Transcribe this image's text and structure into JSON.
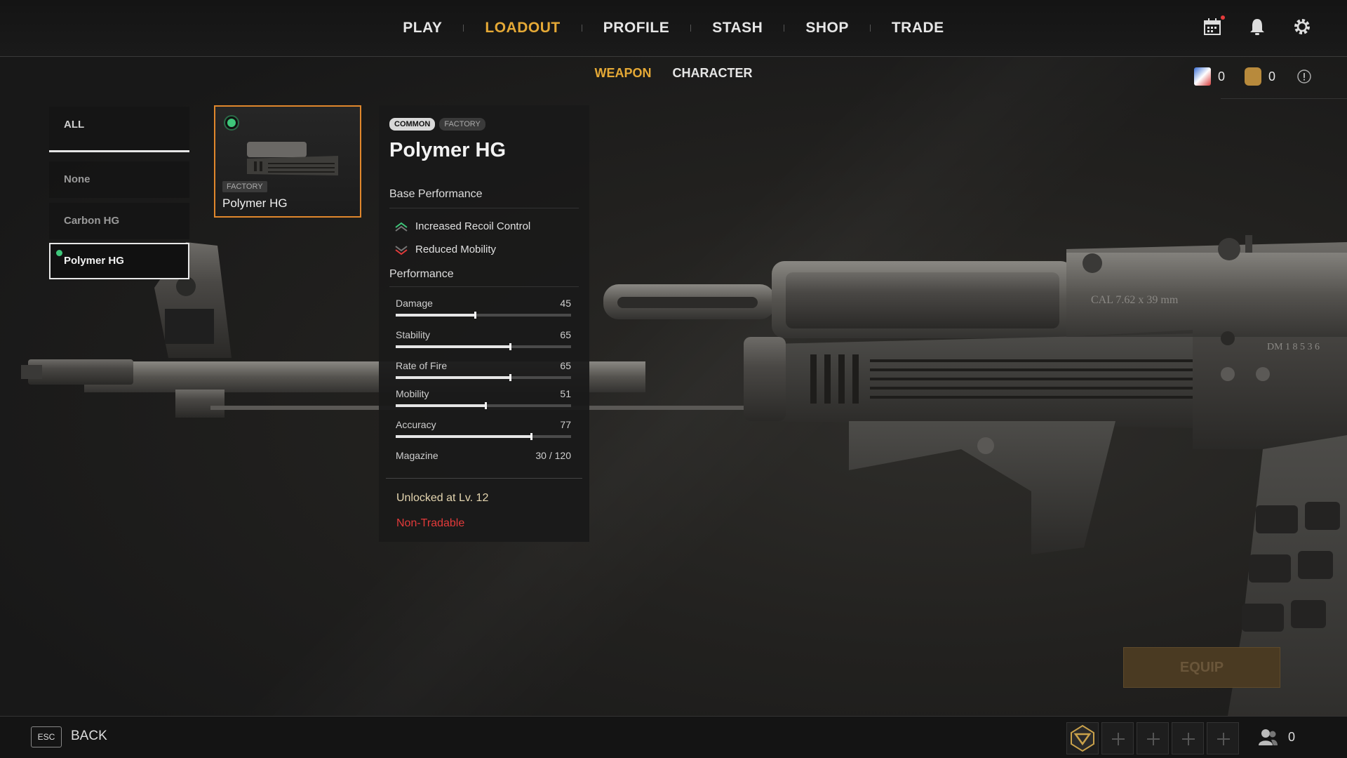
{
  "nav": {
    "items": [
      {
        "label": "PLAY",
        "active": false
      },
      {
        "label": "LOADOUT",
        "active": true
      },
      {
        "label": "PROFILE",
        "active": false
      },
      {
        "label": "STASH",
        "active": false
      },
      {
        "label": "SHOP",
        "active": false
      },
      {
        "label": "TRADE",
        "active": false
      }
    ],
    "icons": [
      "calendar-icon",
      "bell-icon",
      "gear-icon"
    ]
  },
  "subtabs": [
    {
      "label": "WEAPON",
      "active": true
    },
    {
      "label": "CHARACTER",
      "active": false
    }
  ],
  "currency": {
    "saz_amount": "0",
    "sp_amount": "0"
  },
  "sidebar": {
    "filter_label": "ALL",
    "items": [
      {
        "label": "None"
      },
      {
        "label": "Carbon HG"
      },
      {
        "label": "Polymer HG",
        "selected": true
      }
    ]
  },
  "card": {
    "badge": "FACTORY",
    "name": "Polymer HG"
  },
  "detail": {
    "rarity": "COMMON",
    "source": "FACTORY",
    "title": "Polymer HG",
    "base_performance_heading": "Base Performance",
    "base_performance": [
      {
        "label": "Increased Recoil Control",
        "kind": "positive"
      },
      {
        "label": "Reduced Mobility",
        "kind": "negative"
      }
    ],
    "performance_heading": "Performance",
    "stats": [
      {
        "label": "Damage",
        "value": "45",
        "fraction": 0.45
      },
      {
        "label": "Stability",
        "value": "65",
        "fraction": 0.65
      },
      {
        "label": "Rate of Fire",
        "value": "65",
        "fraction": 0.65
      },
      {
        "label": "Mobility",
        "value": "51",
        "fraction": 0.51
      },
      {
        "label": "Accuracy",
        "value": "77",
        "fraction": 0.77
      }
    ],
    "magazine_label": "Magazine",
    "magazine_value": "30 / 120",
    "unlock_text": "Unlocked at Lv. 12",
    "tradable_text": "Non-Tradable"
  },
  "weapon_engraving": "CAL  7.62 x 39 mm",
  "weapon_serial": "DM  1 8 5 3 6",
  "equip_label": "EQUIP",
  "bottom": {
    "esc_key": "ESC",
    "back_label": "BACK",
    "friends_count": "0"
  },
  "colors": {
    "accent": "#e5a936",
    "card_border": "#e0872c",
    "positive": "#3ec77a",
    "negative": "#e23a3a"
  }
}
